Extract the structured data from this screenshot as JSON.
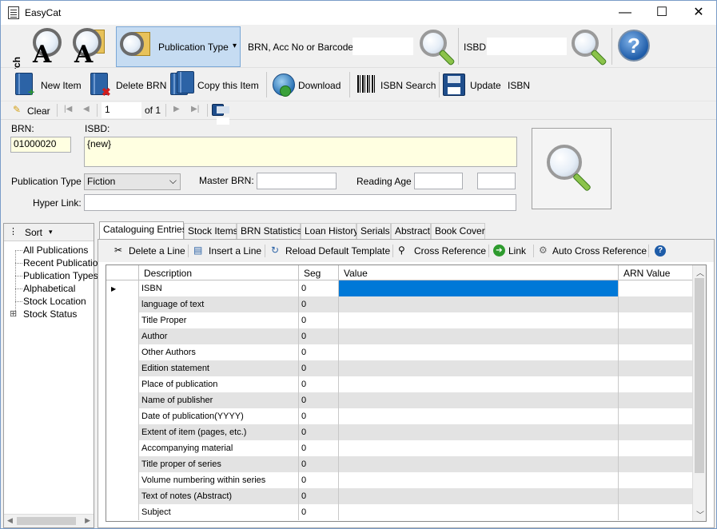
{
  "window": {
    "title": "EasyCat",
    "minimize": "—",
    "maximize": "☐",
    "close": "✕"
  },
  "toolbar1": {
    "search_label": "Search",
    "publication_type_label": "Publication Type",
    "publication_type_caret": "▾",
    "brn_search_label": "BRN, Acc No or Barcode",
    "brn_search_value": "",
    "isbd_label": "ISBD",
    "isbd_value": "",
    "help_glyph": "?"
  },
  "toolbar2": {
    "new_item": "New Item",
    "delete_brn": "Delete BRN",
    "copy_item": "Copy this Item",
    "download": "Download",
    "isbn_search": "ISBN Search",
    "update": "Update",
    "isbn": "ISBN"
  },
  "navbar": {
    "clear": "Clear",
    "first": "|◀",
    "prev": "◀",
    "page_value": "1",
    "of_text": "of 1",
    "next": "▶",
    "last": "▶|"
  },
  "record": {
    "brn_label": "BRN:",
    "brn_value": "01000020",
    "isbd_label": "ISBD:",
    "isbd_value": "{new}",
    "pub_type_label": "Publication Type",
    "pub_type_value": "Fiction",
    "master_brn_label": "Master BRN:",
    "master_brn_value": "",
    "reading_age_label": "Reading Age",
    "reading_age_from": "",
    "reading_age_to": "",
    "hyperlink_label": "Hyper Link:",
    "hyperlink_value": ""
  },
  "tree": {
    "sort_label": "Sort",
    "items": [
      "All Publications",
      "Recent Publication",
      "Publication Types",
      "Alphabetical",
      "Stock Location",
      "Stock Status"
    ],
    "expander": "⊞"
  },
  "tabs": [
    "Cataloguing Entries",
    "Stock Items",
    "BRN Statistics",
    "Loan History",
    "Serials",
    "Abstract",
    "Book Cover"
  ],
  "grid_toolbar": {
    "delete_line": "Delete a Line",
    "insert_line": "Insert a Line",
    "reload_template": "Reload Default Template",
    "cross_reference": "Cross Reference",
    "link": "Link",
    "auto_cross_reference": "Auto Cross Reference"
  },
  "grid": {
    "columns": [
      "Description",
      "Seg",
      "Value",
      "ARN Value"
    ],
    "selected_marker": "▶",
    "rows": [
      {
        "description": "ISBN",
        "seg": "0",
        "value": "",
        "arn": ""
      },
      {
        "description": "language of text",
        "seg": "0",
        "value": "",
        "arn": ""
      },
      {
        "description": "Title Proper",
        "seg": "0",
        "value": "",
        "arn": ""
      },
      {
        "description": "Author",
        "seg": "0",
        "value": "",
        "arn": ""
      },
      {
        "description": "Other Authors",
        "seg": "0",
        "value": "",
        "arn": ""
      },
      {
        "description": "Edition statement",
        "seg": "0",
        "value": "",
        "arn": ""
      },
      {
        "description": "Place of publication",
        "seg": "0",
        "value": "",
        "arn": ""
      },
      {
        "description": "Name of publisher",
        "seg": "0",
        "value": "",
        "arn": ""
      },
      {
        "description": "Date of publication(YYYY)",
        "seg": "0",
        "value": "",
        "arn": ""
      },
      {
        "description": "Extent of item (pages, etc.)",
        "seg": "0",
        "value": "",
        "arn": ""
      },
      {
        "description": "Accompanying material",
        "seg": "0",
        "value": "",
        "arn": ""
      },
      {
        "description": "Title proper of series",
        "seg": "0",
        "value": "",
        "arn": ""
      },
      {
        "description": "Volume numbering within series",
        "seg": "0",
        "value": "",
        "arn": ""
      },
      {
        "description": "Text of notes (Abstract)",
        "seg": "0",
        "value": "",
        "arn": ""
      },
      {
        "description": "Subject",
        "seg": "0",
        "value": "",
        "arn": ""
      }
    ]
  },
  "colors": {
    "selected_cell": "#0078d7",
    "alt_row": "#e3e3e3",
    "field_bg": "#ffffe1",
    "pubtype_active": "#c6dcf2"
  }
}
